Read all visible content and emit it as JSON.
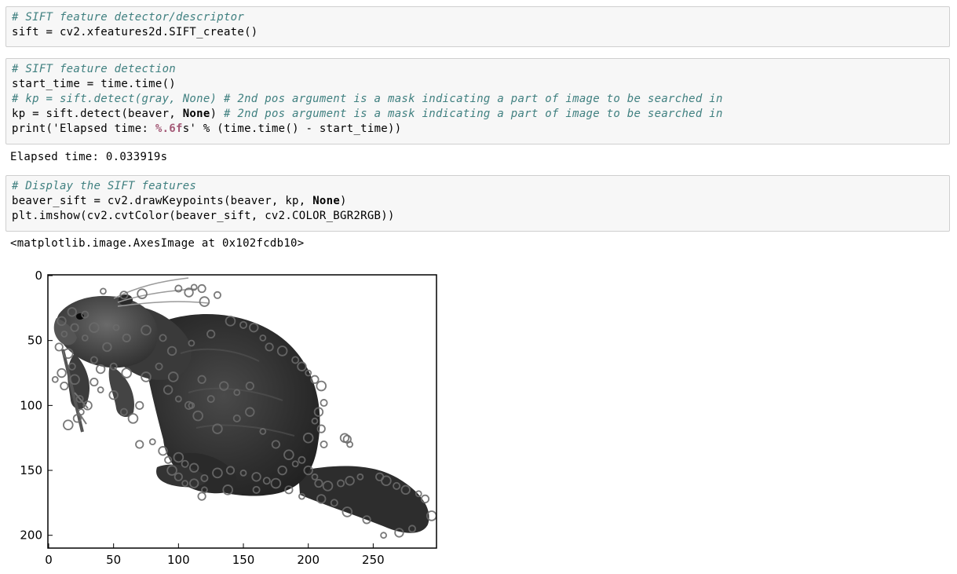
{
  "cells": [
    {
      "lines": [
        {
          "comment": "# SIFT feature detector/descriptor"
        },
        {
          "code": "sift = cv2.xfeatures2d.SIFT_create()"
        }
      ]
    },
    {
      "lines": [
        {
          "comment": "# SIFT feature detection"
        },
        {
          "code": "start_time = time.time()"
        },
        {
          "comment": "# kp = sift.detect(gray, None) # 2nd pos argument is a mask indicating a part of image to be searched in"
        },
        {
          "code_pre": "kp = sift.detect(beaver, ",
          "code_kw": "None",
          "code_post": ") ",
          "code_comment": "# 2nd pos argument is a mask indicating a part of image to be searched in"
        },
        {
          "code_pre": "print('Elapsed time: ",
          "code_fmt": "%.6f",
          "code_post2": "s' % (time.time() - start_time))"
        }
      ],
      "output": "Elapsed time: 0.033919s"
    },
    {
      "lines": [
        {
          "comment": "# Display the SIFT features"
        },
        {
          "code_pre": "beaver_sift = cv2.drawKeypoints(beaver, kp, ",
          "code_kw": "None",
          "code_post": ")"
        },
        {
          "code": "plt.imshow(cv2.cvtColor(beaver_sift, cv2.COLOR_BGR2RGB))"
        }
      ],
      "output": "<matplotlib.image.AxesImage at 0x102fcdb10>"
    }
  ],
  "figure": {
    "x_ticks": [
      "0",
      "50",
      "100",
      "150",
      "200",
      "250"
    ],
    "y_ticks": [
      "0",
      "50",
      "100",
      "150",
      "200"
    ],
    "xlim": [
      0,
      300
    ],
    "ylim": [
      210,
      0
    ],
    "image_subject": "beaver-with-sift-keypoints",
    "keypoint_color": "#6a6a6a"
  }
}
